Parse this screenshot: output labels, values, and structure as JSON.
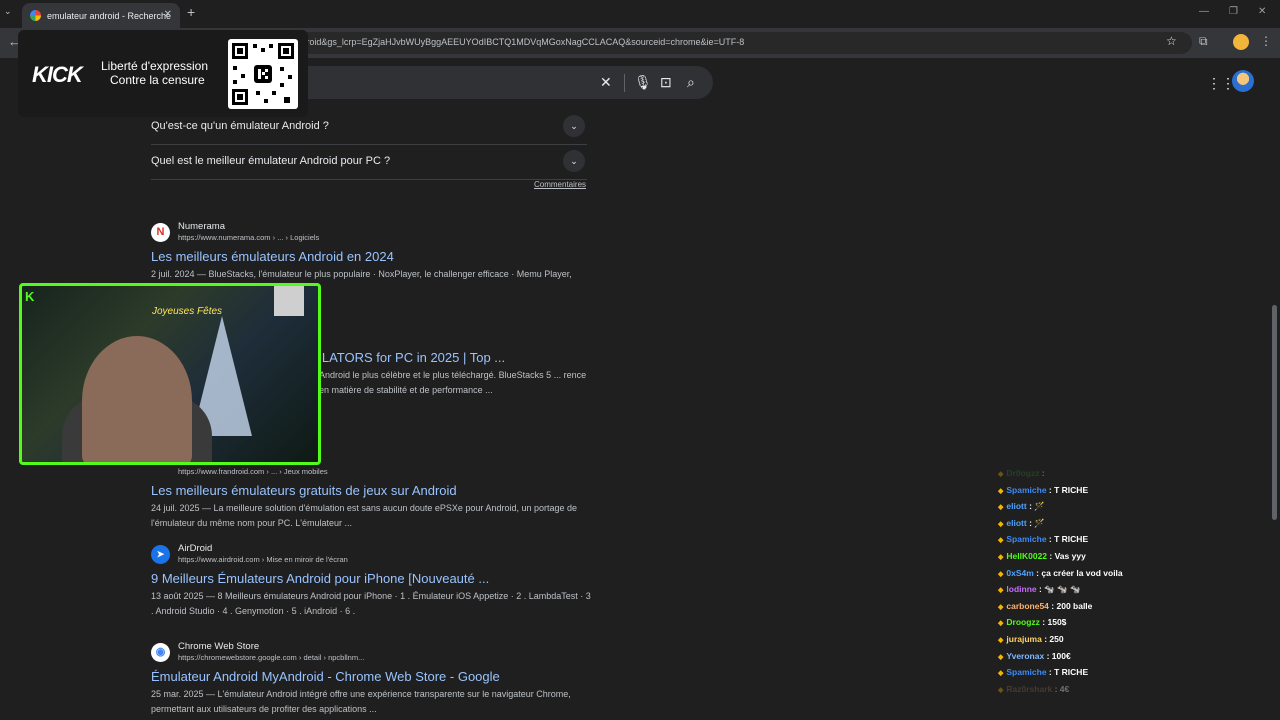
{
  "browser": {
    "tab_title": "emulateur android - Recherche",
    "url": "google.com/search?q=...&oq=emulateur+android&gs_lcrp=EgZjaHJvbWUyBggAEEUYOdIBCTQ1MDVqMGoxNagCCLACAQ&sourceid=chrome&ie=UTF-8",
    "new_tab": "+",
    "close": "✕"
  },
  "kick_banner": {
    "logo": "KICK",
    "line1": "Liberté d'expression",
    "line2": "Contre la censure"
  },
  "faq": [
    {
      "question": "Qu'est-ce qu'un émulateur Android ?"
    },
    {
      "question": "Quel est le meilleur émulateur Android pour PC ?"
    }
  ],
  "comments_link": "Commentaires",
  "results": [
    {
      "site": "Numerama",
      "url": "https://www.numerama.com › ... › Logiciels",
      "title": "Les meilleurs émulateurs Android en 2024",
      "snippet": "2 juil. 2024 — BlueStacks, l'émulateur le plus populaire · NoxPlayer, le challenger efficace · Memu Player, l'essentiel et ...",
      "icon": "N"
    },
    {
      "site": "",
      "url": "",
      "title": "...LATORS for PC in 2025 | Top ...",
      "snippet": "Android le plus célèbre et le plus téléchargé. BlueStacks 5 ... rence en matière de stabilité et de performance ...",
      "icon": ""
    },
    {
      "site": "",
      "url": "https://www.frandroid.com › ... › Jeux mobiles",
      "title": "Les meilleurs émulateurs gratuits de jeux sur Android",
      "snippet": "24 juil. 2025 — La meilleure solution d'émulation est sans aucun doute ePSXe pour Android, un portage de l'émulateur du même nom pour PC. L'émulateur ...",
      "icon": ""
    },
    {
      "site": "AirDroid",
      "url": "https://www.airdroid.com › Mise en miroir de l'écran",
      "title": "9 Meilleurs Émulateurs Android pour iPhone [Nouveauté ...",
      "snippet": "13 août 2025 — 8 Meilleurs émulateurs Android pour iPhone · 1 . Émulateur iOS Appetize · 2 . LambdaTest · 3 . Android Studio · 4 . Genymotion · 5 . iAndroid · 6 .",
      "icon": "➤"
    },
    {
      "site": "Chrome Web Store",
      "url": "https://chromewebstore.google.com › detail › npcbllnm...",
      "title": "Émulateur Android MyAndroid - Chrome Web Store - Google",
      "snippet": "25 mar. 2025 — L'émulateur Android intégré offre une expérience transparente sur le navigateur Chrome, permettant aux utilisateurs de profiter des applications ...",
      "icon": "◉"
    }
  ],
  "webcam": {
    "neon_sign": "Joyeuses Fêtes",
    "logo": "K"
  },
  "chat": [
    {
      "user": "Dr0ogzz",
      "text": "",
      "color": "#2e7d32"
    },
    {
      "user": "Spamiche",
      "text": "T RICHE",
      "color": "#3d8af7"
    },
    {
      "user": "eliott",
      "text": "🪄",
      "color": "#4da3ff"
    },
    {
      "user": "eliott",
      "text": "🪄",
      "color": "#4da3ff"
    },
    {
      "user": "Spamiche",
      "text": "T RICHE",
      "color": "#3d8af7"
    },
    {
      "user": "HellK0022",
      "text": "Vas yyy",
      "color": "#53fc18"
    },
    {
      "user": "0xS4m",
      "text": "ça créer la vod voila",
      "color": "#4da3ff"
    },
    {
      "user": "lodinne",
      "text": "🐄 🐄 🐄",
      "color": "#c86bff"
    },
    {
      "user": "carbone54",
      "text": "200 balle",
      "color": "#ffb36b"
    },
    {
      "user": "Droogzz",
      "text": "150$",
      "color": "#53fc18"
    },
    {
      "user": "jurajuma",
      "text": "250",
      "color": "#ffd36b"
    },
    {
      "user": "Yveronax",
      "text": "100€",
      "color": "#7fb8ff"
    },
    {
      "user": "Spamiche",
      "text": "T RICHE",
      "color": "#3d8af7"
    },
    {
      "user": "Raz0rshark",
      "text": "4€",
      "color": "#8a6a58"
    }
  ]
}
